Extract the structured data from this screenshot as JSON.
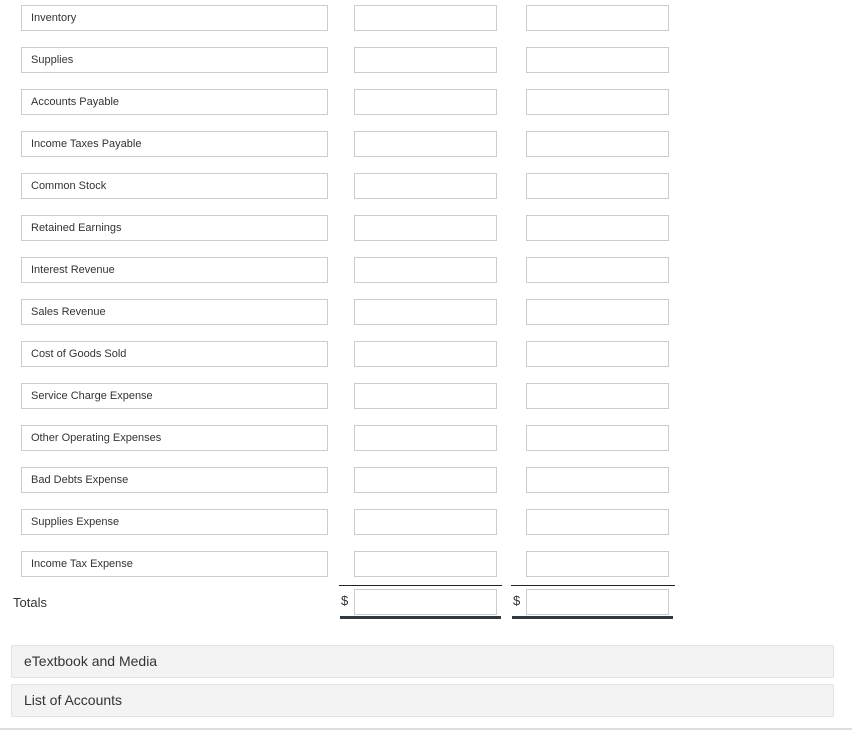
{
  "accounts": [
    {
      "label": "Inventory",
      "debit": "",
      "credit": ""
    },
    {
      "label": "Supplies",
      "debit": "",
      "credit": ""
    },
    {
      "label": "Accounts Payable",
      "debit": "",
      "credit": ""
    },
    {
      "label": "Income Taxes Payable",
      "debit": "",
      "credit": ""
    },
    {
      "label": "Common Stock",
      "debit": "",
      "credit": ""
    },
    {
      "label": "Retained Earnings",
      "debit": "",
      "credit": ""
    },
    {
      "label": "Interest Revenue",
      "debit": "",
      "credit": ""
    },
    {
      "label": "Sales Revenue",
      "debit": "",
      "credit": ""
    },
    {
      "label": "Cost of Goods Sold",
      "debit": "",
      "credit": ""
    },
    {
      "label": "Service Charge Expense",
      "debit": "",
      "credit": ""
    },
    {
      "label": "Other Operating Expenses",
      "debit": "",
      "credit": ""
    },
    {
      "label": "Bad Debts Expense",
      "debit": "",
      "credit": ""
    },
    {
      "label": "Supplies Expense",
      "debit": "",
      "credit": ""
    },
    {
      "label": "Income Tax Expense",
      "debit": "",
      "credit": ""
    }
  ],
  "totals": {
    "label": "Totals",
    "currency_symbol": "$",
    "debit": "",
    "credit": ""
  },
  "panels": {
    "etextbook": "eTextbook and Media",
    "list_of_accounts": "List of Accounts"
  },
  "colors": {
    "input_border": "#cccccc",
    "panel_bg": "#f3f3f3",
    "total_rule": "#2d3a44"
  }
}
